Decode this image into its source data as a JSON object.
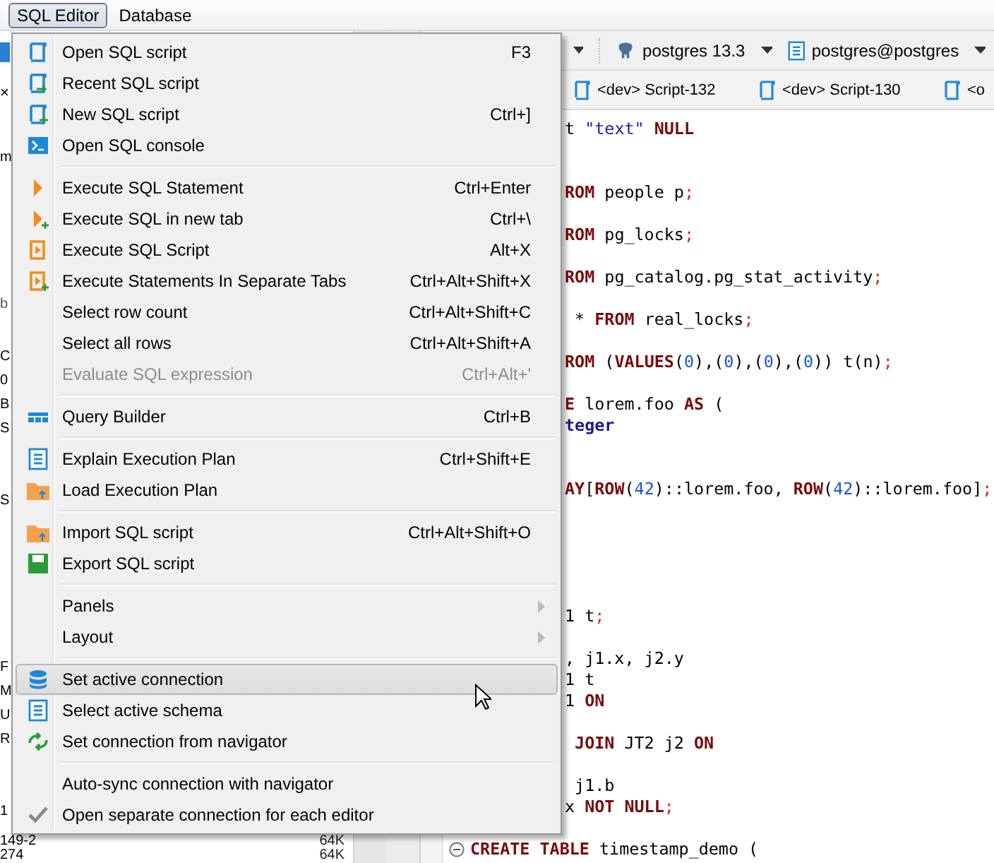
{
  "menubar": [
    {
      "label": "SQL Editor",
      "selected": true
    },
    {
      "label": "Database",
      "selected": false
    }
  ],
  "navigator": {
    "close": "×",
    "filter_fragment": "m",
    "header_fragment": "b",
    "rows": [
      {
        "name": "C"
      },
      {
        "name": "0"
      },
      {
        "name": "B"
      },
      {
        "name": "S"
      },
      {
        "name": "S"
      },
      {
        "name": "F"
      },
      {
        "name": "M"
      },
      {
        "name": "U"
      },
      {
        "name": "R"
      },
      {
        "name": "1"
      },
      {
        "name": "149-2",
        "size": "64K"
      },
      {
        "name": "274",
        "size": "64K"
      }
    ]
  },
  "toolbar": {
    "datasource": "postgres 13.3",
    "schema": "postgres@postgres"
  },
  "tabs": [
    {
      "label": "<dev> Script-132",
      "selected": false
    },
    {
      "label": "<dev> Script-130",
      "selected": false
    },
    {
      "label": "<o",
      "selected": false
    }
  ],
  "code": [
    {
      "kind": "partial",
      "tokens": [
        {
          "text": "t ",
          "kind": "plain"
        },
        {
          "text": "\"text\" ",
          "kind": "string"
        },
        {
          "text": "NULL",
          "kind": "keyword"
        }
      ]
    },
    {
      "kind": "partial",
      "tokens": [
        {
          "text": "ROM",
          "kind": "keyword"
        },
        {
          "text": " people p",
          "kind": "plain"
        },
        {
          "text": ";",
          "kind": "punct"
        }
      ]
    },
    {
      "kind": "partial",
      "tokens": [
        {
          "text": "ROM",
          "kind": "keyword"
        },
        {
          "text": " pg_locks",
          "kind": "plain"
        },
        {
          "text": ";",
          "kind": "punct"
        }
      ]
    },
    {
      "kind": "partial",
      "tokens": [
        {
          "text": "ROM",
          "kind": "keyword"
        },
        {
          "text": " pg_catalog.pg_stat_activity",
          "kind": "plain"
        },
        {
          "text": ";",
          "kind": "punct"
        }
      ]
    },
    {
      "kind": "partial",
      "tokens": [
        {
          "text": " * ",
          "kind": "plain"
        },
        {
          "text": "FROM",
          "kind": "keyword"
        },
        {
          "text": " real_locks",
          "kind": "plain"
        },
        {
          "text": ";",
          "kind": "punct"
        }
      ]
    },
    {
      "kind": "partial",
      "tokens": [
        {
          "text": "ROM",
          "kind": "keyword"
        },
        {
          "text": " (",
          "kind": "plain"
        },
        {
          "text": "VALUES",
          "kind": "keyword"
        },
        {
          "text": "(",
          "kind": "plain"
        },
        {
          "text": "0",
          "kind": "number"
        },
        {
          "text": "),(",
          "kind": "plain"
        },
        {
          "text": "0",
          "kind": "number"
        },
        {
          "text": "),(",
          "kind": "plain"
        },
        {
          "text": "0",
          "kind": "number"
        },
        {
          "text": "),(",
          "kind": "plain"
        },
        {
          "text": "0",
          "kind": "number"
        },
        {
          "text": ")) t(n)",
          "kind": "plain"
        },
        {
          "text": ";",
          "kind": "punct"
        }
      ]
    },
    {
      "kind": "partial",
      "tokens": [
        {
          "text": "E",
          "kind": "keyword"
        },
        {
          "text": " lorem.foo ",
          "kind": "plain"
        },
        {
          "text": "AS",
          "kind": "keyword"
        },
        {
          "text": " (",
          "kind": "plain"
        }
      ]
    },
    {
      "kind": "partial",
      "tokens": [
        {
          "text": "teger",
          "kind": "type"
        }
      ]
    },
    {
      "kind": "partial",
      "tokens": [
        {
          "text": "AY",
          "kind": "keyword"
        },
        {
          "text": "[",
          "kind": "plain"
        },
        {
          "text": "ROW",
          "kind": "keyword"
        },
        {
          "text": "(",
          "kind": "plain"
        },
        {
          "text": "42",
          "kind": "number"
        },
        {
          "text": ")::lorem.foo, ",
          "kind": "plain"
        },
        {
          "text": "ROW",
          "kind": "keyword"
        },
        {
          "text": "(",
          "kind": "plain"
        },
        {
          "text": "42",
          "kind": "number"
        },
        {
          "text": ")::lorem.foo]",
          "kind": "plain"
        },
        {
          "text": ";",
          "kind": "punct"
        }
      ]
    },
    {
      "kind": "partial",
      "tokens": [
        {
          "text": "1 t",
          "kind": "plain"
        },
        {
          "text": ";",
          "kind": "punct"
        }
      ]
    },
    {
      "kind": "partial",
      "tokens": [
        {
          "text": ", j1.x, j2.y",
          "kind": "plain"
        }
      ]
    },
    {
      "kind": "partial",
      "tokens": [
        {
          "text": "1 t",
          "kind": "plain"
        }
      ]
    },
    {
      "kind": "partial",
      "tokens": [
        {
          "text": "1 ",
          "kind": "plain"
        },
        {
          "text": "ON",
          "kind": "keyword"
        }
      ]
    },
    {
      "kind": "partial",
      "tokens": [
        {
          "text": " JOIN",
          "kind": "keyword"
        },
        {
          "text": " JT2 j2 ",
          "kind": "plain"
        },
        {
          "text": "ON",
          "kind": "keyword"
        }
      ]
    },
    {
      "kind": "partial",
      "tokens": [
        {
          "text": " j1.b",
          "kind": "plain"
        }
      ]
    },
    {
      "kind": "partial",
      "tokens": [
        {
          "text": "x ",
          "kind": "plain"
        },
        {
          "text": "NOT NULL",
          "kind": "keyword"
        },
        {
          "text": ";",
          "kind": "punct"
        }
      ]
    },
    {
      "kind": "full",
      "tokens": [
        {
          "text": "CREATE TABLE",
          "kind": "keyword"
        },
        {
          "text": " timestamp_demo (",
          "kind": "plain"
        }
      ]
    }
  ],
  "menu": [
    [
      {
        "label": "Open SQL script",
        "kind": "script",
        "shortcut": "F3",
        "disabled": false,
        "selected": false
      },
      {
        "label": "Recent SQL script",
        "kind": "script-arrow",
        "disabled": false,
        "selected": false
      },
      {
        "label": "New SQL script",
        "kind": "script-plus",
        "shortcut": "Ctrl+]",
        "disabled": false,
        "selected": false
      },
      {
        "label": "Open SQL console",
        "kind": "console",
        "disabled": false,
        "selected": false
      }
    ],
    [
      {
        "label": "Execute SQL Statement",
        "kind": "play",
        "shortcut": "Ctrl+Enter",
        "disabled": false,
        "selected": false
      },
      {
        "label": "Execute SQL in new tab",
        "kind": "play-plus",
        "shortcut": "Ctrl+\\",
        "disabled": false,
        "selected": false
      },
      {
        "label": "Execute SQL Script",
        "kind": "script-play",
        "shortcut": "Alt+X",
        "disabled": false,
        "selected": false
      },
      {
        "label": "Execute Statements In Separate Tabs",
        "kind": "script-play-plus",
        "shortcut": "Ctrl+Alt+Shift+X",
        "disabled": false,
        "selected": false
      },
      {
        "label": "Select row count",
        "kind": "plain",
        "shortcut": "Ctrl+Alt+Shift+C",
        "disabled": false,
        "selected": false
      },
      {
        "label": "Select all rows",
        "kind": "plain",
        "shortcut": "Ctrl+Alt+Shift+A",
        "disabled": false,
        "selected": false
      },
      {
        "label": "Evaluate SQL expression",
        "kind": "plain",
        "shortcut": "Ctrl+Alt+'",
        "disabled": true,
        "selected": false
      }
    ],
    [
      {
        "label": "Query Builder",
        "kind": "builder",
        "shortcut": "Ctrl+B",
        "disabled": false,
        "selected": false
      }
    ],
    [
      {
        "label": "Explain Execution Plan",
        "kind": "plan",
        "shortcut": "Ctrl+Shift+E",
        "disabled": false,
        "selected": false
      },
      {
        "label": "Load Execution Plan",
        "kind": "folder",
        "disabled": false,
        "selected": false
      }
    ],
    [
      {
        "label": "Import SQL script",
        "kind": "folder",
        "shortcut": "Ctrl+Alt+Shift+O",
        "disabled": false,
        "selected": false
      },
      {
        "label": "Export SQL script",
        "kind": "save",
        "disabled": false,
        "selected": false
      }
    ],
    [
      {
        "label": "Panels",
        "kind": "submenu",
        "disabled": false,
        "selected": false
      },
      {
        "label": "Layout",
        "kind": "submenu",
        "disabled": false,
        "selected": false
      }
    ],
    [
      {
        "label": "Set active connection",
        "kind": "database",
        "disabled": false,
        "selected": true
      },
      {
        "label": "Select active schema",
        "kind": "schema",
        "disabled": false,
        "selected": false
      },
      {
        "label": "Set connection from navigator",
        "kind": "sync",
        "disabled": false,
        "selected": false
      }
    ],
    [
      {
        "label": "Auto-sync connection with navigator",
        "kind": "check",
        "checked": false,
        "disabled": false,
        "selected": false
      },
      {
        "label": "Open separate connection for each editor",
        "kind": "check",
        "checked": true,
        "disabled": false,
        "selected": false
      }
    ]
  ]
}
